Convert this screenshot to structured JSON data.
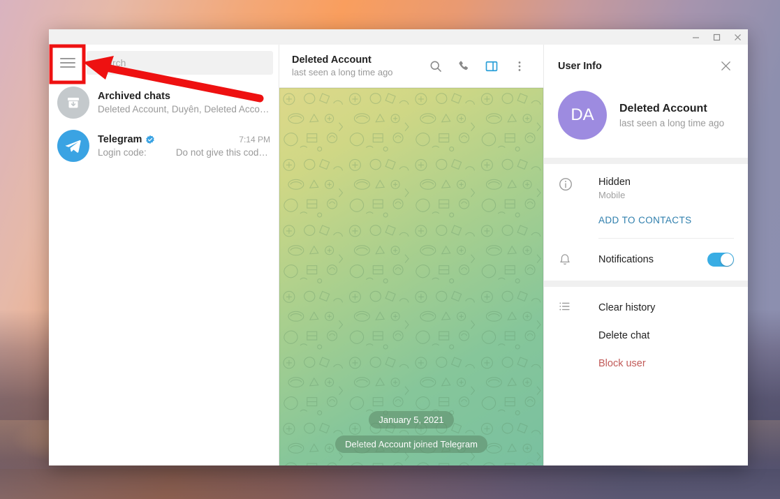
{
  "window": {
    "controls": [
      {
        "name": "minimize",
        "glyph": "–"
      },
      {
        "name": "maximize",
        "glyph": "☐"
      },
      {
        "name": "close",
        "glyph": "✕"
      }
    ]
  },
  "sidebar": {
    "menu_icon": "hamburger-menu-icon",
    "search": {
      "placeholder": "Search",
      "value": ""
    },
    "chats": [
      {
        "name": "Archived chats",
        "preview": "Deleted Account, Duyên, Deleted Accoun…",
        "time": "",
        "avatar_icon": "archive-box-icon",
        "verified": false
      },
      {
        "name": "Telegram",
        "preview_label": "Login code:",
        "preview": "Do not give this code …",
        "time": "7:14 PM",
        "avatar_icon": "telegram-logo-icon",
        "verified": true
      }
    ]
  },
  "chat": {
    "title": "Deleted Account",
    "status": "last seen a long time ago",
    "actions": [
      {
        "name": "search-icon",
        "active": false
      },
      {
        "name": "phone-icon",
        "active": false
      },
      {
        "name": "info-panel-toggle-icon",
        "active": true
      },
      {
        "name": "more-menu-icon",
        "active": false
      }
    ],
    "date_chip": "January 5, 2021",
    "service_message": "Deleted Account joined Telegram"
  },
  "user_info": {
    "title": "User Info",
    "close_icon": "close-icon",
    "avatar_initials": "DA",
    "avatar_color": "#9d8be0",
    "name": "Deleted Account",
    "status": "last seen a long time ago",
    "phone": {
      "icon": "info-circle-icon",
      "value": "Hidden",
      "label": "Mobile"
    },
    "add_to_contacts": "ADD TO CONTACTS",
    "notifications": {
      "icon": "bell-icon",
      "label": "Notifications",
      "enabled": true
    },
    "actions_icon": "list-icon",
    "actions": [
      {
        "label": "Clear history",
        "danger": false
      },
      {
        "label": "Delete chat",
        "danger": false
      },
      {
        "label": "Block user",
        "danger": true
      }
    ]
  },
  "annotation": {
    "highlight_color": "#ee1111",
    "arrow_color": "#ee1111",
    "target": "hamburger-menu-icon"
  },
  "colors": {
    "accent_blue": "#39ade4",
    "link_blue": "#2f7fad",
    "danger_red": "#c15a58",
    "avatar_purple": "#9d8be0"
  }
}
